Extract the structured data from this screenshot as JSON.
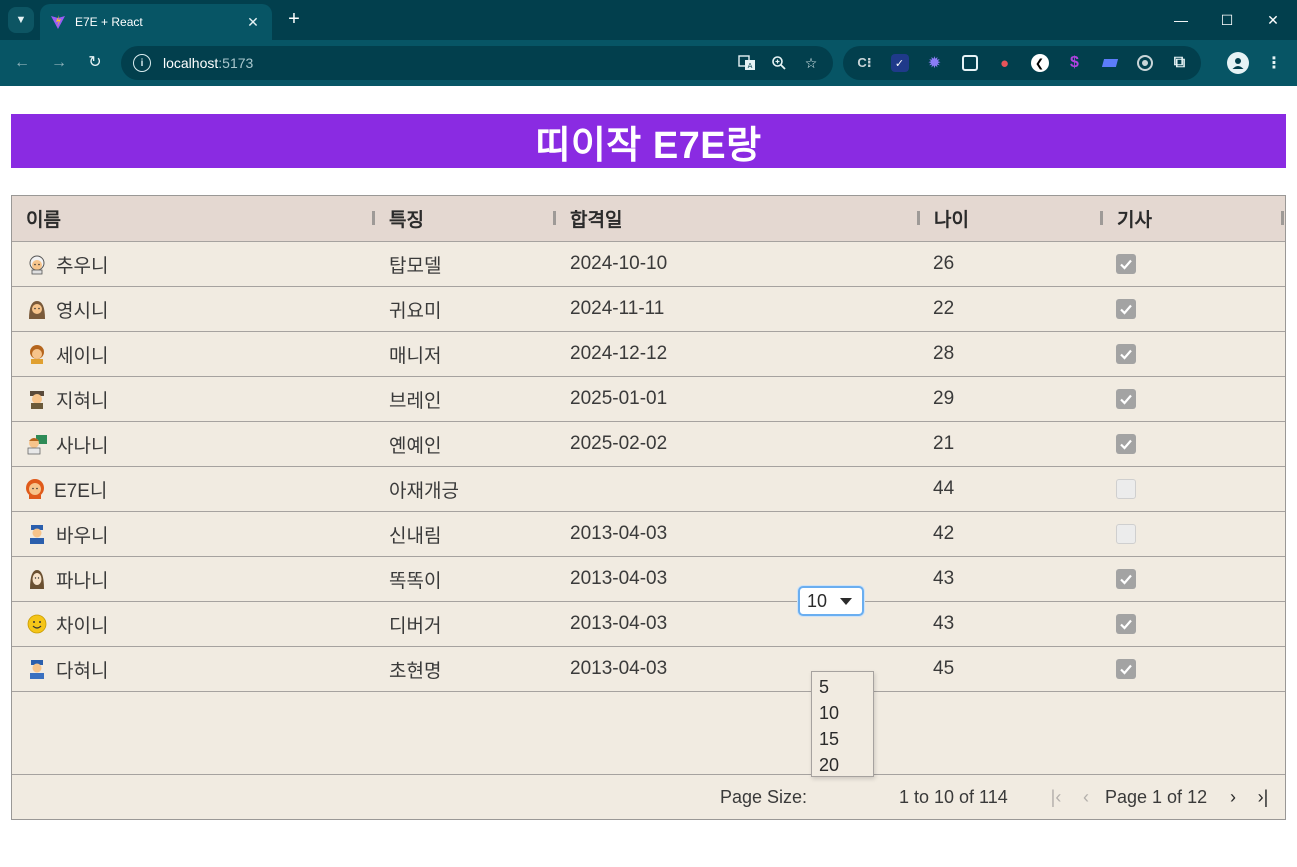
{
  "browser": {
    "tab_title": "E7E + React",
    "url_host": "localhost",
    "url_port": ":5173",
    "extensions": [
      "C-extension-icon",
      "check-extension-icon",
      "gear-extension-icon",
      "tablet-extension-icon",
      "bird-extension-icon",
      "back-circle-extension-icon",
      "s-extension-icon",
      "tag-extension-icon",
      "target-extension-icon",
      "puzzle-extension-icon"
    ]
  },
  "banner": {
    "title": "띠이작 E7E랑",
    "color": "#8a2be2"
  },
  "grid": {
    "columns": [
      "이름",
      "특징",
      "합격일",
      "나이",
      "기사"
    ],
    "rows": [
      {
        "emoji": "person-white-hair-emoji",
        "name": "추우니",
        "feature": "탑모델",
        "date": "2024-10-10",
        "age": "26",
        "checked": true
      },
      {
        "emoji": "woman-headscarf-emoji",
        "name": "영시니",
        "feature": "귀요미",
        "date": "2024-11-11",
        "age": "22",
        "checked": true
      },
      {
        "emoji": "woman-bowing-emoji",
        "name": "세이니",
        "feature": "매니저",
        "date": "2024-12-12",
        "age": "28",
        "checked": true
      },
      {
        "emoji": "detective-emoji",
        "name": "지혀니",
        "feature": "브레인",
        "date": "2025-01-01",
        "age": "29",
        "checked": true
      },
      {
        "emoji": "teacher-emoji",
        "name": "사나니",
        "feature": "옌예인",
        "date": "2025-02-02",
        "age": "21",
        "checked": true
      },
      {
        "emoji": "woman-red-hair-emoji",
        "name": "E7E니",
        "feature": "아재개긍",
        "date": "",
        "age": "44",
        "checked": false
      },
      {
        "emoji": "police-officer-emoji",
        "name": "바우니",
        "feature": "신내림",
        "date": "2013-04-03",
        "age": "42",
        "checked": false
      },
      {
        "emoji": "nun-emoji",
        "name": "파나니",
        "feature": "똑똑이",
        "date": "2013-04-03",
        "age": "43",
        "checked": true
      },
      {
        "emoji": "smiling-face-emoji",
        "name": "차이니",
        "feature": "디버거",
        "date": "2013-04-03",
        "age": "43",
        "checked": true
      },
      {
        "emoji": "police-woman-emoji",
        "name": "다혀니",
        "feature": "초현명",
        "date": "2013-04-03",
        "age": "45",
        "checked": true
      }
    ]
  },
  "pagination": {
    "page_size_label": "Page Size:",
    "page_size_value": "10",
    "page_size_options": [
      "5",
      "10",
      "15",
      "20"
    ],
    "range_text": "1 to 10 of 114",
    "page_text": "Page 1 of 12",
    "first_icon": "first-page-icon",
    "prev_icon": "prev-page-icon",
    "next_icon": "next-page-icon",
    "last_icon": "last-page-icon"
  }
}
